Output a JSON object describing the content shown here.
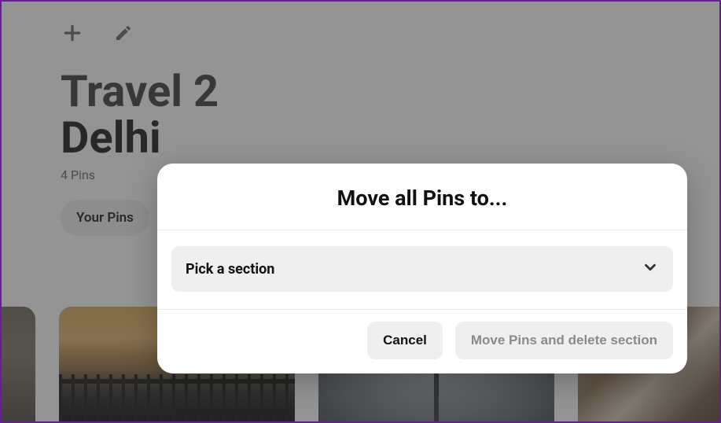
{
  "board": {
    "title": "Travel 2",
    "section": "Delhi",
    "pin_count_text": "4 Pins"
  },
  "tabs": {
    "your_pins": "Your Pins"
  },
  "modal": {
    "title": "Move all Pins to...",
    "picker_label": "Pick a section",
    "cancel_label": "Cancel",
    "confirm_label": "Move Pins and delete section"
  },
  "icons": {
    "add": "plus-icon",
    "edit": "pencil-icon",
    "chevron": "chevron-down-icon"
  }
}
